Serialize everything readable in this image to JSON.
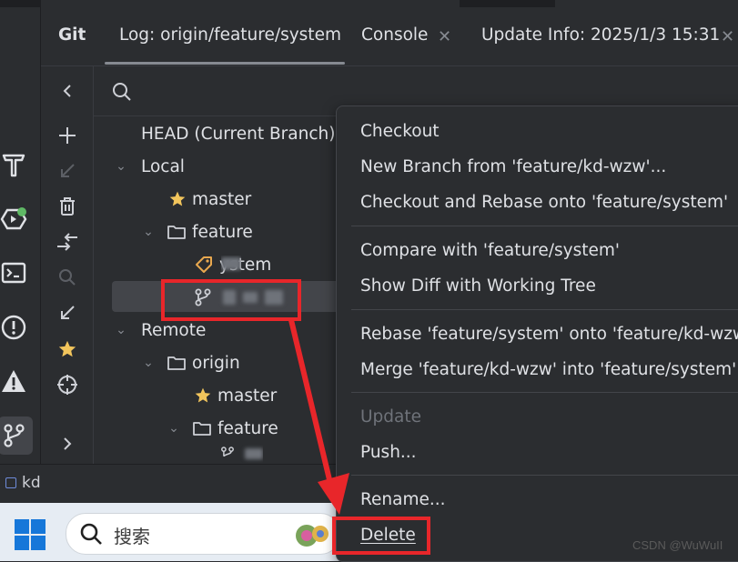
{
  "tabs": {
    "git": "Git",
    "log": "Log: origin/feature/system",
    "console": "Console",
    "update_info": "Update Info: 2025/1/3 15:31"
  },
  "tree": {
    "head": "HEAD (Current Branch)",
    "local": "Local",
    "local_master": "master",
    "local_feature": "feature",
    "local_feature_system": "system",
    "remote": "Remote",
    "origin": "origin",
    "origin_master": "master",
    "origin_feature": "feature"
  },
  "statusbar": {
    "project": "kd"
  },
  "taskbar": {
    "search_placeholder": "搜索"
  },
  "context_menu": {
    "checkout": "Checkout",
    "new_branch": "New Branch from 'feature/kd-wzw'...",
    "checkout_rebase": "Checkout and Rebase onto 'feature/system'",
    "compare": "Compare with 'feature/system'",
    "show_diff": "Show Diff with Working Tree",
    "rebase": "Rebase 'feature/system' onto 'feature/kd-wzw'",
    "merge": "Merge 'feature/kd-wzw' into 'feature/system'",
    "update": "Update",
    "push": "Push...",
    "rename": "Rename...",
    "delete": "Delete"
  },
  "watermark": "CSDN @WuWuII",
  "colors": {
    "background": "#2b2d30",
    "text": "#dfe1e5",
    "annotation_red": "#e8262a",
    "star": "#f2c55c",
    "tag": "#e9a84f",
    "notification_green": "#5fb865"
  }
}
